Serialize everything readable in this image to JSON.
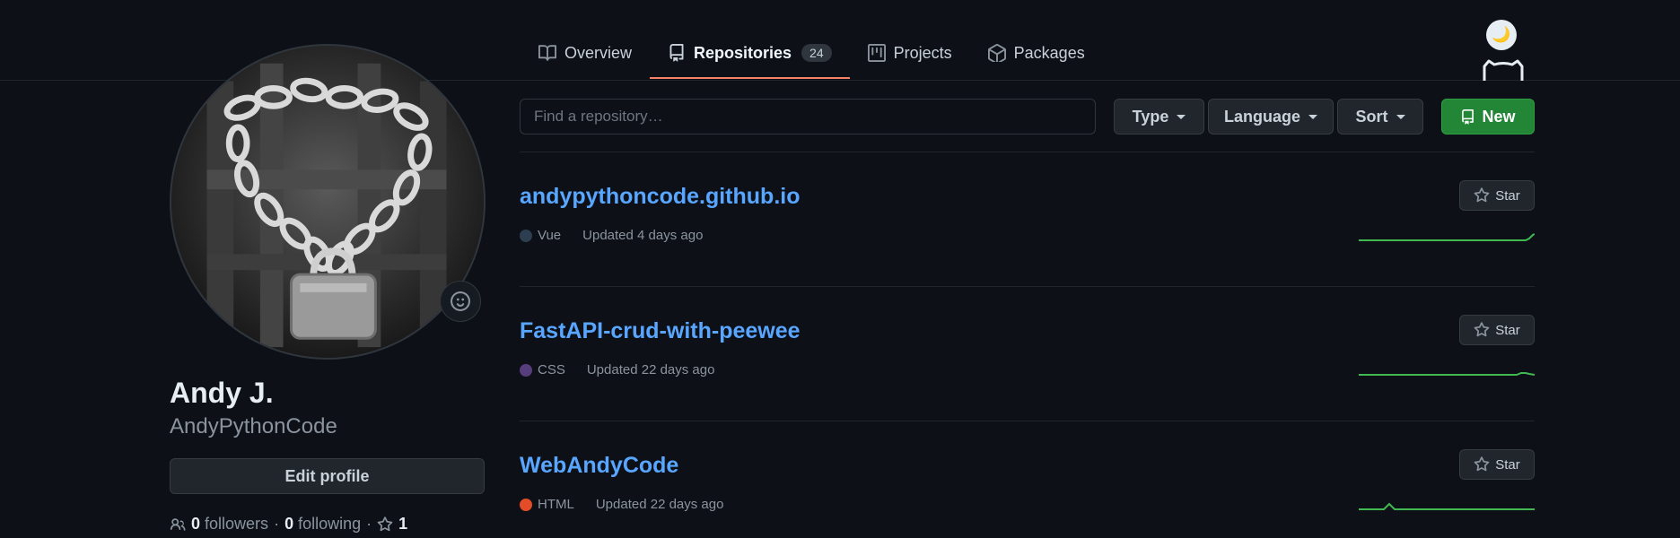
{
  "nav": {
    "tabs": [
      {
        "label": "Overview",
        "icon": "book-icon"
      },
      {
        "label": "Repositories",
        "icon": "repo-icon",
        "count": "24",
        "active": true
      },
      {
        "label": "Projects",
        "icon": "project-icon"
      },
      {
        "label": "Packages",
        "icon": "package-icon"
      }
    ]
  },
  "theme_toggle": {
    "glyph": "🌙"
  },
  "profile": {
    "name": "Andy J.",
    "username": "AndyPythonCode",
    "edit_label": "Edit profile",
    "followers_count": "0",
    "followers_label": "followers",
    "following_count": "0",
    "following_label": "following",
    "stars_count": "1",
    "separator": "·"
  },
  "search": {
    "placeholder": "Find a repository…",
    "value": ""
  },
  "filters": {
    "type_label": "Type",
    "language_label": "Language",
    "sort_label": "Sort"
  },
  "new_button": {
    "label": "New"
  },
  "repos": [
    {
      "name": "andypythoncode.github.io",
      "language": "Vue",
      "lang_color": "#2c3e50",
      "updated": "Updated 4 days ago",
      "star_label": "Star"
    },
    {
      "name": "FastAPI-crud-with-peewee",
      "language": "CSS",
      "lang_color": "#563d7c",
      "updated": "Updated 22 days ago",
      "star_label": "Star"
    },
    {
      "name": "WebAndyCode",
      "language": "HTML",
      "lang_color": "#e34c26",
      "updated": "Updated 22 days ago",
      "star_label": "Star"
    }
  ],
  "colors": {
    "accent": "#58a6ff",
    "tab_underline": "#f78166",
    "new_button": "#238636",
    "sparkline": "#3fb950"
  }
}
